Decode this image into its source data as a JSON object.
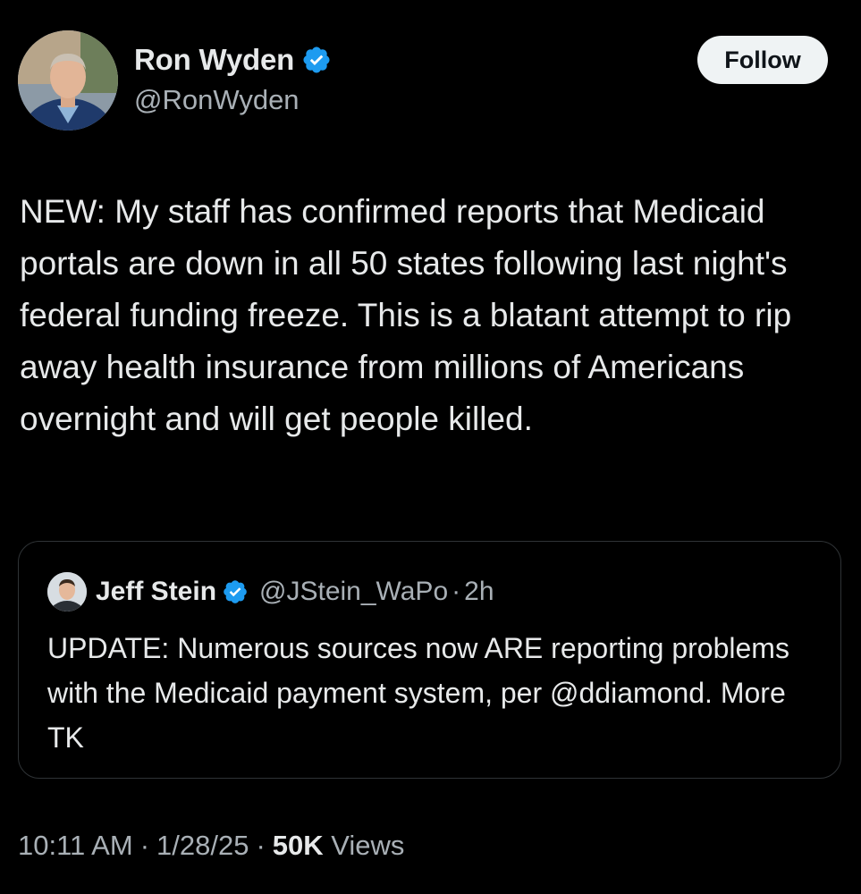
{
  "tweet": {
    "author": {
      "name": "Ron Wyden",
      "handle": "@RonWyden",
      "verified": true
    },
    "follow_label": "Follow",
    "text": "NEW: My staff has confirmed reports that Medicaid portals are down in all 50 states following last night's federal funding freeze. This is a blatant attempt to rip away health insurance from millions of Americans overnight and will get people killed.",
    "quote": {
      "author": {
        "name": "Jeff Stein",
        "handle": "@JStein_WaPo",
        "verified": true
      },
      "separator": "·",
      "time": "2h",
      "text": "UPDATE: Numerous sources now ARE reporting problems with the Medicaid payment system, per @ddiamond. More TK"
    },
    "meta": {
      "time": "10:11 AM",
      "separator": "·",
      "date": "1/28/25",
      "views_count": "50K",
      "views_label": "Views"
    }
  },
  "icons": {
    "verified": "verified-badge-icon"
  },
  "colors": {
    "background": "#000000",
    "text_primary": "#e7e9ea",
    "text_secondary": "#a9b0b6",
    "verified_badge": "#1d9bf0",
    "border": "#2f3336",
    "follow_button_bg": "#eff3f4",
    "follow_button_text": "#0f1419"
  }
}
